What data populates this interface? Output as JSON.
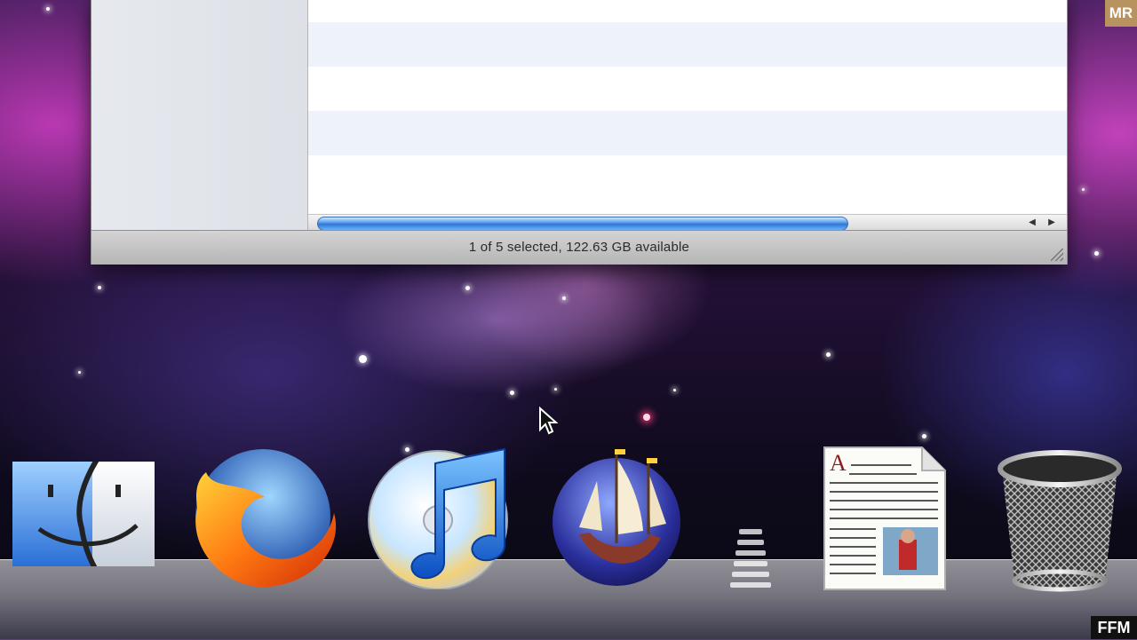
{
  "finder_window": {
    "status_text": "1 of 5 selected, 122.63 GB available"
  },
  "dock": {
    "items": [
      {
        "name": "Finder",
        "icon": "finder-icon"
      },
      {
        "name": "Firefox",
        "icon": "firefox-icon"
      },
      {
        "name": "iTunes",
        "icon": "itunes-icon"
      },
      {
        "name": "Camino",
        "icon": "camino-icon"
      },
      {
        "name": "Document",
        "icon": "document-icon"
      },
      {
        "name": "Trash",
        "icon": "trash-icon"
      }
    ]
  },
  "watermarks": {
    "top_right": "MR",
    "bottom_right": "FFM"
  }
}
